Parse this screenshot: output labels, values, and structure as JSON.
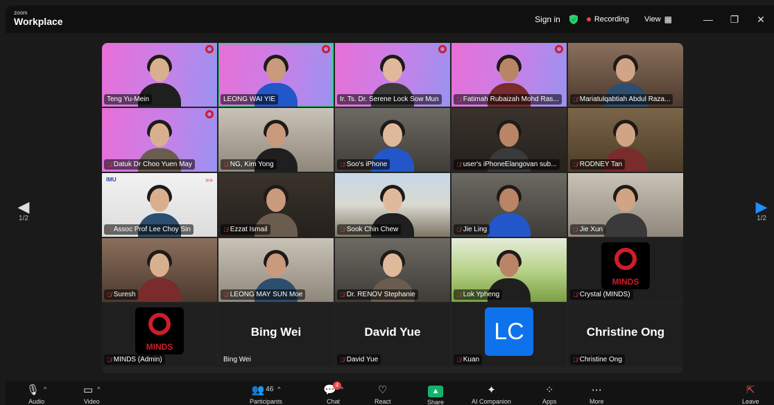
{
  "titlebar": {
    "brand_small": "zoom",
    "brand_big": "Workplace",
    "sign_in": "Sign in",
    "recording": "Recording",
    "view": "View",
    "view_icon": "grid-icon",
    "shield_color": "#2ecc71"
  },
  "pager": {
    "left": "1/2",
    "right": "1/2"
  },
  "tiles": [
    {
      "name": "Teng Yu-Mein",
      "muted": false,
      "bg": "pink",
      "logo": true
    },
    {
      "name": "LEONG WAI YIE",
      "muted": false,
      "bg": "pink",
      "logo": true,
      "active": true
    },
    {
      "name": "Ir. Ts. Dr. Serene Lock Sow Mun",
      "muted": false,
      "bg": "pink",
      "logo": true
    },
    {
      "name": "Fatimah Rubaizah Mohd Ras...",
      "muted": true,
      "bg": "pink",
      "logo": true
    },
    {
      "name": "Mariatulqabtiah Abdul Raza...",
      "muted": true,
      "bg": "warm"
    },
    {
      "name": "Datuk Dr Choo Yuen May",
      "muted": true,
      "bg": "pink",
      "logo": true
    },
    {
      "name": "NG, Kim Yong",
      "muted": true,
      "bg": "wall"
    },
    {
      "name": "Soo's iPhone",
      "muted": true,
      "bg": "room"
    },
    {
      "name": "user's iPhoneElangovan sub...",
      "muted": true,
      "bg": "dark"
    },
    {
      "name": "RODNEY Tan",
      "muted": true,
      "bg": "shelf"
    },
    {
      "name": "Assoc Prof Lee Choy Sin",
      "muted": true,
      "bg": "white"
    },
    {
      "name": "Ezzat Ismail",
      "muted": true,
      "bg": "dark"
    },
    {
      "name": "Sook Chin Chew",
      "muted": true,
      "bg": "sky"
    },
    {
      "name": "Jie Ling",
      "muted": true,
      "bg": "room"
    },
    {
      "name": "Jie Xun",
      "muted": true,
      "bg": "wall"
    },
    {
      "name": "Suresh",
      "muted": true,
      "bg": "warm"
    },
    {
      "name": "LEONG MAY SUN Moe",
      "muted": true,
      "bg": "wall"
    },
    {
      "name": "Dr. RENOV Stephanie",
      "muted": true,
      "bg": "room"
    },
    {
      "name": "Lok Ypheng",
      "muted": true,
      "bg": "grass"
    },
    {
      "name": "Crystal (MINDS)",
      "muted": true,
      "bg": "black",
      "avatar": "minds"
    },
    {
      "name": "MINDS (Admin)",
      "muted": true,
      "bg": "black",
      "avatar": "minds"
    },
    {
      "name": "Bing Wei",
      "muted": false,
      "bg": "black",
      "display": "Bing Wei"
    },
    {
      "name": "David Yue",
      "muted": true,
      "bg": "black",
      "display": "David Yue"
    },
    {
      "name": "Kuan",
      "muted": true,
      "bg": "black",
      "avatar": "initials",
      "initials": "LC"
    },
    {
      "name": "Christine Ong",
      "muted": true,
      "bg": "black",
      "display": "Christine Ong"
    }
  ],
  "minds_word": "MINDS",
  "imu_logo": "IMU",
  "toolbar": {
    "audio": "Audio",
    "video": "Video",
    "participants": "Participants",
    "participant_count": "46",
    "chat": "Chat",
    "chat_badge": "4",
    "react": "React",
    "share": "Share",
    "ai_companion": "AI Companion",
    "apps": "Apps",
    "more": "More",
    "leave": "Leave"
  }
}
